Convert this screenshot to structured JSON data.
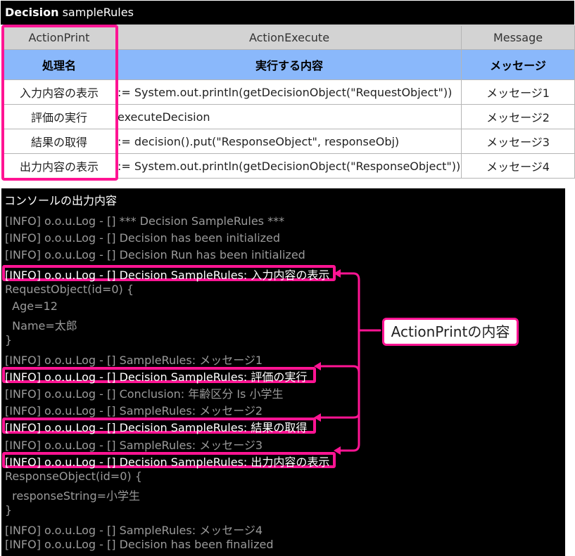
{
  "decision": {
    "keyword": "Decision",
    "name": "sampleRules",
    "columns": [
      "ActionPrint",
      "ActionExecute",
      "Message"
    ],
    "subheaders": [
      "処理名",
      "実行する内容",
      "メッセージ"
    ],
    "rows": [
      {
        "print": "入力内容の表示",
        "execute": ":= System.out.println(getDecisionObject(\"RequestObject\"))",
        "message": "メッセージ1"
      },
      {
        "print": "評価の実行",
        "execute": "executeDecision",
        "message": "メッセージ2"
      },
      {
        "print": "結果の取得",
        "execute": ":= decision().put(\"ResponseObject\", responseObj)",
        "message": "メッセージ3"
      },
      {
        "print": "出力内容の表示",
        "execute": ":= System.out.println(getDecisionObject(\"ResponseObject\"))",
        "message": "メッセージ4"
      }
    ]
  },
  "console": {
    "title": "コンソールの出力内容",
    "lines": [
      {
        "text": "[INFO] o.o.u.Log - [] *** Decision SampleRules ***",
        "highlight": false
      },
      {
        "text": "[INFO] o.o.u.Log - [] Decision has been initialized",
        "highlight": false
      },
      {
        "text": "[INFO] o.o.u.Log - [] Decision Run has been initialized",
        "highlight": false
      },
      {
        "text": "[INFO] o.o.u.Log - [] Decision SampleRules: 入力内容の表示",
        "highlight": true
      },
      {
        "text": "RequestObject(id=0) {",
        "highlight": false
      },
      {
        "text": "  Age=12",
        "highlight": false
      },
      {
        "text": "  Name=太郎",
        "highlight": false
      },
      {
        "text": "}",
        "highlight": false
      },
      {
        "text": "[INFO] o.o.u.Log - [] SampleRules: メッセージ1",
        "highlight": false
      },
      {
        "text": "[INFO] o.o.u.Log - [] Decision SampleRules: 評価の実行",
        "highlight": true
      },
      {
        "text": "[INFO] o.o.u.Log - [] Conclusion: 年齢区分 Is 小学生",
        "highlight": false
      },
      {
        "text": "[INFO] o.o.u.Log - [] SampleRules: メッセージ2",
        "highlight": false
      },
      {
        "text": "[INFO] o.o.u.Log - [] Decision SampleRules: 結果の取得",
        "highlight": true
      },
      {
        "text": "[INFO] o.o.u.Log - [] SampleRules: メッセージ3",
        "highlight": false
      },
      {
        "text": "[INFO] o.o.u.Log - [] Decision SampleRules: 出力内容の表示",
        "highlight": true
      },
      {
        "text": "ResponseObject(id=0) {",
        "highlight": false
      },
      {
        "text": "  responseString=小学生",
        "highlight": false
      },
      {
        "text": "}",
        "highlight": false
      },
      {
        "text": "[INFO] o.o.u.Log - [] SampleRules: メッセージ4",
        "highlight": false
      },
      {
        "text": "[INFO] o.o.u.Log - [] Decision has been finalized",
        "highlight": false
      }
    ]
  },
  "callout": {
    "label": "ActionPrintの内容"
  },
  "colors": {
    "accent": "#ff1493",
    "header": "#d3d3d3",
    "subheader": "#8ab8fb",
    "console_bg": "#000000"
  }
}
